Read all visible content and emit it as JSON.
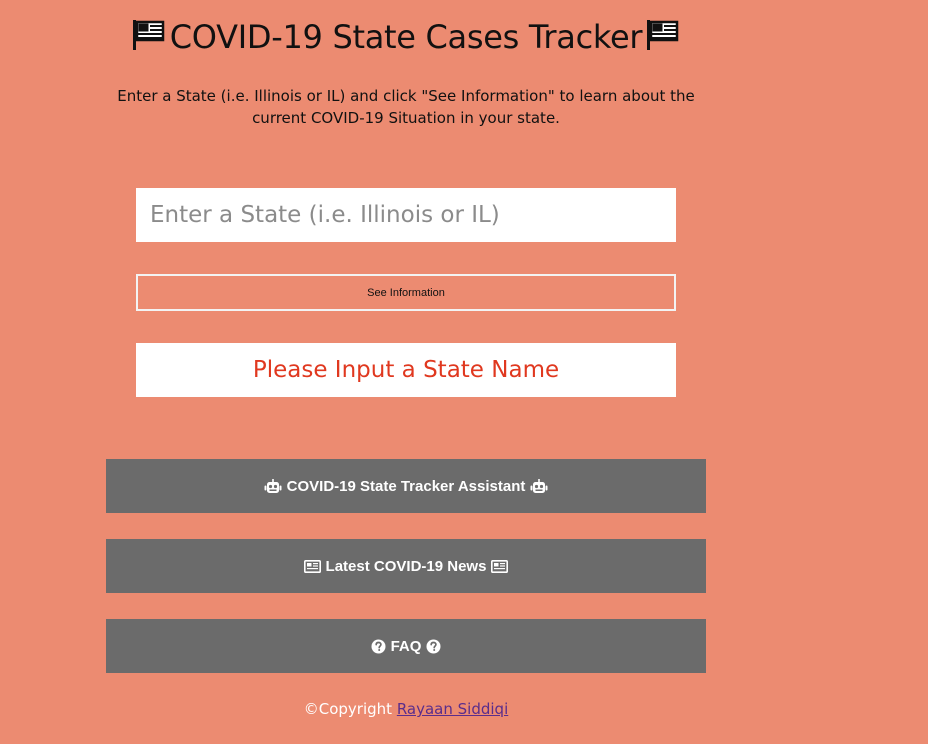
{
  "header": {
    "title": "COVID-19 State Cases Tracker",
    "subtitle": "Enter a State (i.e. Illinois or IL) and click \"See Information\" to learn about the current COVID-19 Situation in your state."
  },
  "search": {
    "placeholder": "Enter a State (i.e. Illinois or IL)",
    "value": "",
    "button_label": "See Information"
  },
  "result": {
    "message": "Please Input a State Name"
  },
  "nav": {
    "assistant_label": "COVID-19 State Tracker Assistant",
    "news_label": "Latest COVID-19 News",
    "faq_label": "FAQ"
  },
  "footer": {
    "copyright_text": "©Copyright",
    "author_link": "Rayaan Siddiqi"
  },
  "icons": {
    "title_flag": "us-flag-icon",
    "assistant": "robot-icon",
    "news": "newspaper-icon",
    "faq": "question-circle-icon"
  },
  "colors": {
    "background": "#ec8b71",
    "button": "#6b6b6b",
    "result_text": "#e0381f",
    "link": "#5a2d8c"
  }
}
